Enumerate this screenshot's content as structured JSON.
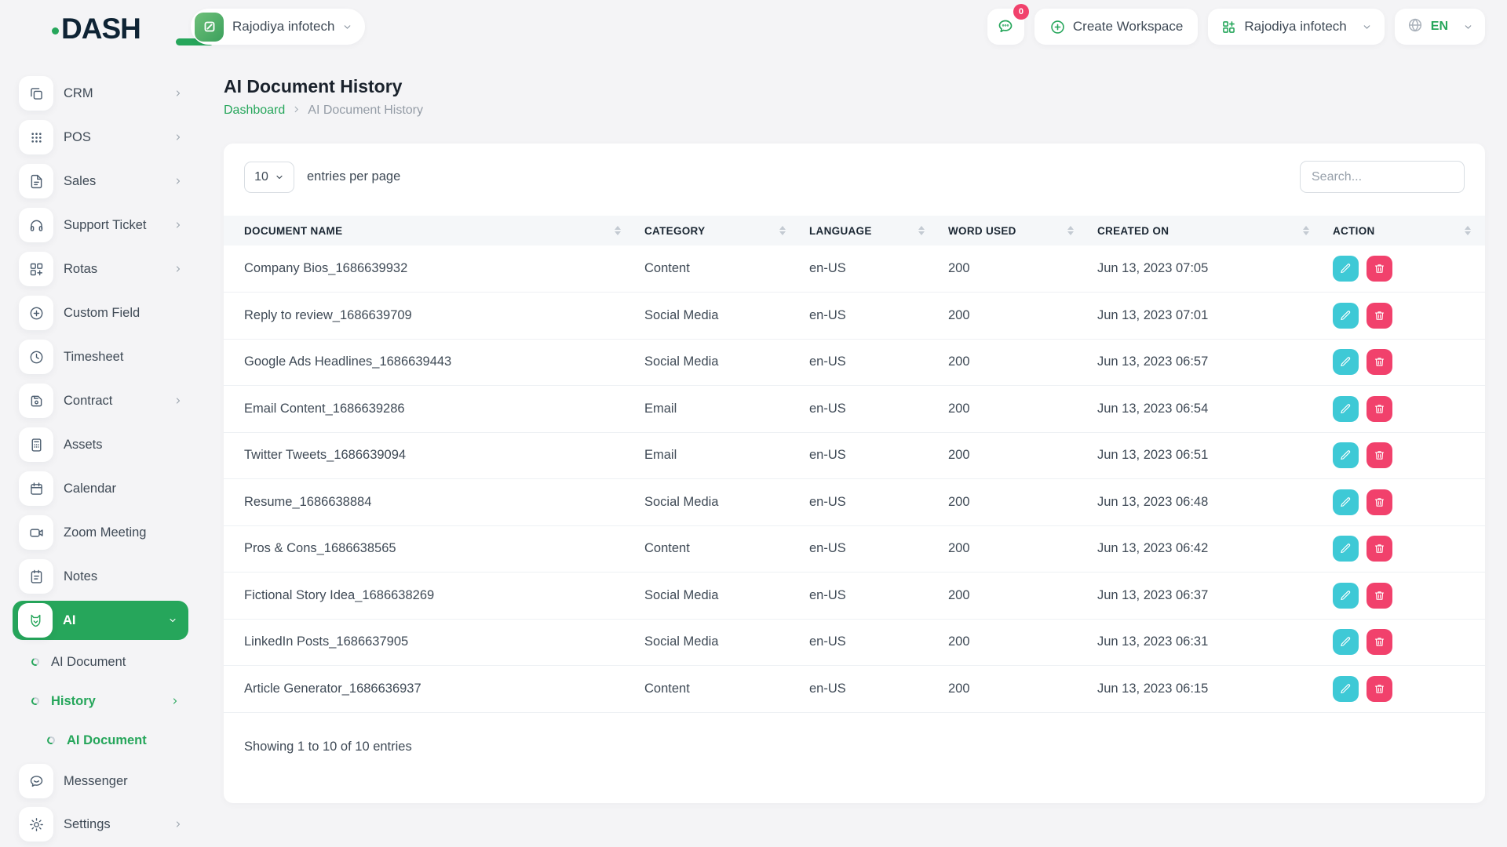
{
  "brand": {
    "logo_text": "DASH"
  },
  "topbar": {
    "workspace_name": "Rajodiya infotech",
    "chat_badge": "0",
    "create_workspace_label": "Create Workspace",
    "workspace_switcher": "Rajodiya infotech",
    "language": "EN"
  },
  "sidebar": {
    "items": [
      {
        "label": "CRM"
      },
      {
        "label": "POS"
      },
      {
        "label": "Sales"
      },
      {
        "label": "Support Ticket"
      },
      {
        "label": "Rotas"
      },
      {
        "label": "Custom Field"
      },
      {
        "label": "Timesheet"
      },
      {
        "label": "Contract"
      },
      {
        "label": "Assets"
      },
      {
        "label": "Calendar"
      },
      {
        "label": "Zoom Meeting"
      },
      {
        "label": "Notes"
      },
      {
        "label": "AI"
      },
      {
        "label": "AI Document"
      },
      {
        "label": "History"
      },
      {
        "label": "AI Document"
      },
      {
        "label": "Messenger"
      },
      {
        "label": "Settings"
      }
    ]
  },
  "page": {
    "title": "AI Document History",
    "breadcrumb_root": "Dashboard",
    "breadcrumb_current": "AI Document History"
  },
  "controls": {
    "page_size": "10",
    "entries_label": "entries per page",
    "search_placeholder": "Search..."
  },
  "table": {
    "columns": [
      "DOCUMENT NAME",
      "CATEGORY",
      "LANGUAGE",
      "WORD USED",
      "CREATED ON",
      "ACTION"
    ],
    "rows": [
      {
        "name": "Company Bios_1686639932",
        "category": "Content",
        "language": "en-US",
        "words": "200",
        "created": "Jun 13, 2023 07:05"
      },
      {
        "name": "Reply to review_1686639709",
        "category": "Social Media",
        "language": "en-US",
        "words": "200",
        "created": "Jun 13, 2023 07:01"
      },
      {
        "name": "Google Ads Headlines_1686639443",
        "category": "Social Media",
        "language": "en-US",
        "words": "200",
        "created": "Jun 13, 2023 06:57"
      },
      {
        "name": "Email Content_1686639286",
        "category": "Email",
        "language": "en-US",
        "words": "200",
        "created": "Jun 13, 2023 06:54"
      },
      {
        "name": "Twitter Tweets_1686639094",
        "category": "Email",
        "language": "en-US",
        "words": "200",
        "created": "Jun 13, 2023 06:51"
      },
      {
        "name": "Resume_1686638884",
        "category": "Social Media",
        "language": "en-US",
        "words": "200",
        "created": "Jun 13, 2023 06:48"
      },
      {
        "name": "Pros & Cons_1686638565",
        "category": "Content",
        "language": "en-US",
        "words": "200",
        "created": "Jun 13, 2023 06:42"
      },
      {
        "name": "Fictional Story Idea_1686638269",
        "category": "Social Media",
        "language": "en-US",
        "words": "200",
        "created": "Jun 13, 2023 06:37"
      },
      {
        "name": "LinkedIn Posts_1686637905",
        "category": "Social Media",
        "language": "en-US",
        "words": "200",
        "created": "Jun 13, 2023 06:31"
      },
      {
        "name": "Article Generator_1686636937",
        "category": "Content",
        "language": "en-US",
        "words": "200",
        "created": "Jun 13, 2023 06:15"
      }
    ],
    "summary": "Showing 1 to 10 of 10 entries"
  },
  "colors": {
    "primary_green": "#26a65b",
    "edit_teal": "#3ec9d6",
    "delete_pink": "#f1416c",
    "badge_pink": "#f1416c",
    "dark_navy": "#0e2334"
  }
}
